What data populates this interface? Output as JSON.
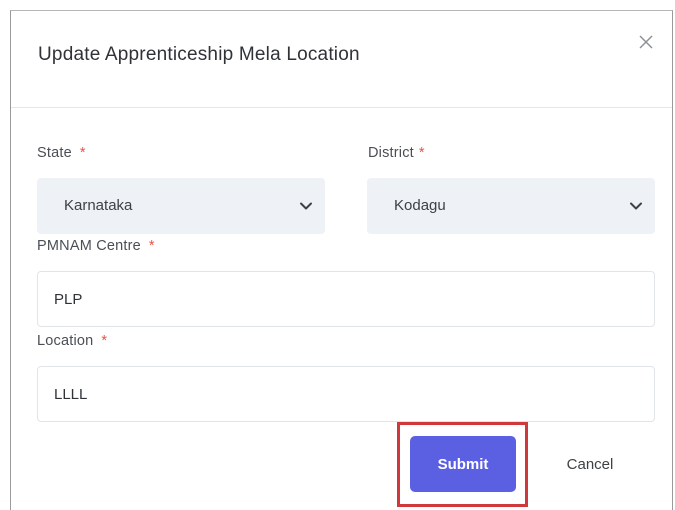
{
  "modal": {
    "title": "Update Apprenticeship Mela Location",
    "close_icon": "close-icon"
  },
  "form": {
    "state": {
      "label": "State",
      "required_mark": "*",
      "value": "Karnataka"
    },
    "district": {
      "label": "District",
      "required_mark": "*",
      "value": "Kodagu"
    },
    "pmnam_centre": {
      "label": "PMNAM Centre",
      "required_mark": "*",
      "value": "PLP"
    },
    "location": {
      "label": "Location",
      "required_mark": "*",
      "value": "LLLL"
    }
  },
  "actions": {
    "submit_label": "Submit",
    "cancel_label": "Cancel"
  },
  "colors": {
    "primary": "#5b60e3",
    "required": "#e5534b",
    "highlight": "#d0393b",
    "select_bg": "#eef2f6"
  }
}
